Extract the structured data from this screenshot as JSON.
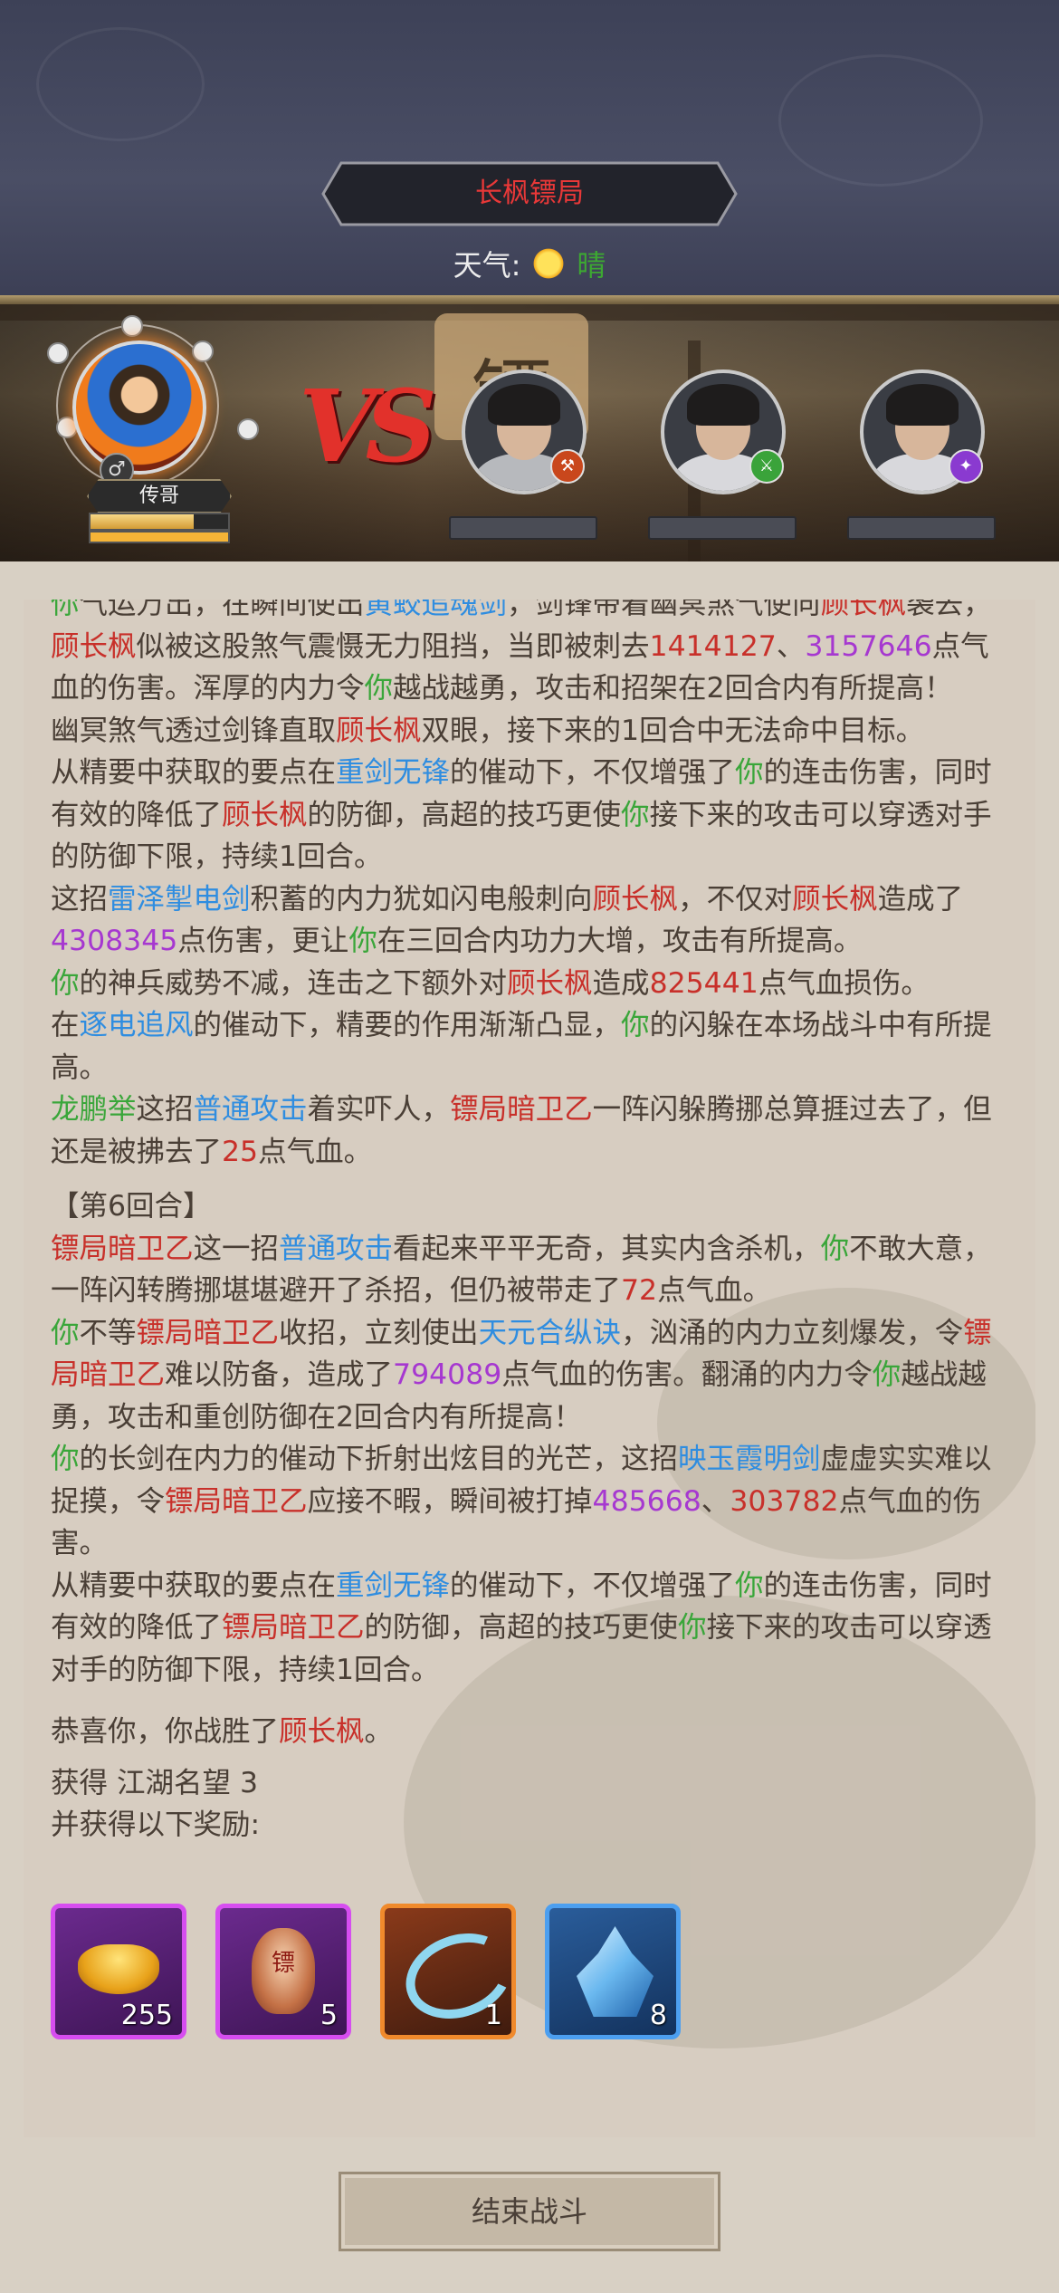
{
  "header": {
    "title": "长枫镖局",
    "weather_label": "天气:",
    "weather_value": "晴",
    "weather_icon": "sun-icon"
  },
  "banner": {
    "sign_char": "镖",
    "vs_text": "VS",
    "hero": {
      "name": "传哥",
      "gender_icon": "♂",
      "hp_fraction": 0.75,
      "energy_fraction": 1.0
    },
    "enemies": [
      {
        "weapon_icon": "axe-icon",
        "weapon_color": "#c9471c"
      },
      {
        "weapon_icon": "sword-icon",
        "weapon_color": "#3aa33a"
      },
      {
        "weapon_icon": "staff-icon",
        "weapon_color": "#8a3ad0"
      }
    ]
  },
  "log": {
    "lines": [
      [
        {
          "t": "你",
          "c": "g"
        },
        {
          "t": "气运万出，在瞬间使出"
        },
        {
          "t": "黄蛟追魂剑",
          "c": "b"
        },
        {
          "t": "，剑锋带着幽冥煞气使向"
        },
        {
          "t": "顾长枫",
          "c": "r"
        },
        {
          "t": "袭去，"
        },
        {
          "t": "顾长枫",
          "c": "r"
        },
        {
          "t": "似被这股煞气震慑无力阻挡，当即被刺去"
        },
        {
          "t": "1414127",
          "c": "r"
        },
        {
          "t": "、"
        },
        {
          "t": "3157646",
          "c": "p"
        },
        {
          "t": "点气血的伤害。浑厚的内力令"
        },
        {
          "t": "你",
          "c": "g"
        },
        {
          "t": "越战越勇，攻击和招架在2回合内有所提高！"
        }
      ],
      [
        {
          "t": "幽冥煞气透过剑锋直取"
        },
        {
          "t": "顾长枫",
          "c": "r"
        },
        {
          "t": "双眼，接下来的1回合中无法命中目标。"
        }
      ],
      [
        {
          "t": "从精要中获取的要点在"
        },
        {
          "t": "重剑无锋",
          "c": "b"
        },
        {
          "t": "的催动下，不仅增强了"
        },
        {
          "t": "你",
          "c": "g"
        },
        {
          "t": "的连击伤害，同时有效的降低了"
        },
        {
          "t": "顾长枫",
          "c": "r"
        },
        {
          "t": "的防御，高超的技巧更使"
        },
        {
          "t": "你",
          "c": "g"
        },
        {
          "t": "接下来的攻击可以穿透对手的防御下限，持续1回合。"
        }
      ],
      [
        {
          "t": "这招"
        },
        {
          "t": "雷泽掣电剑",
          "c": "b"
        },
        {
          "t": "积蓄的内力犹如闪电般刺向"
        },
        {
          "t": "顾长枫",
          "c": "r"
        },
        {
          "t": "，不仅对"
        },
        {
          "t": "顾长枫",
          "c": "r"
        },
        {
          "t": "造成了"
        },
        {
          "t": "4308345",
          "c": "p"
        },
        {
          "t": "点伤害，更让"
        },
        {
          "t": "你",
          "c": "g"
        },
        {
          "t": "在三回合内功力大增，攻击有所提高。"
        }
      ],
      [
        {
          "t": "你",
          "c": "g"
        },
        {
          "t": "的神兵威势不减，连击之下额外对"
        },
        {
          "t": "顾长枫",
          "c": "r"
        },
        {
          "t": "造成"
        },
        {
          "t": "825441",
          "c": "r"
        },
        {
          "t": "点气血损伤。"
        }
      ],
      [
        {
          "t": "在"
        },
        {
          "t": "逐电追风",
          "c": "b"
        },
        {
          "t": "的催动下，精要的作用渐渐凸显，"
        },
        {
          "t": "你",
          "c": "g"
        },
        {
          "t": "的闪躲在本场战斗中有所提高。"
        }
      ],
      [
        {
          "t": "龙鹏举",
          "c": "g"
        },
        {
          "t": "这招"
        },
        {
          "t": "普通攻击",
          "c": "b"
        },
        {
          "t": "着实吓人，"
        },
        {
          "t": "镖局暗卫乙",
          "c": "r"
        },
        {
          "t": "一阵闪躲腾挪总算捱过去了，但还是被拂去了"
        },
        {
          "t": "25",
          "c": "r"
        },
        {
          "t": "点气血。"
        }
      ]
    ],
    "round_label": "【第6回合】",
    "round_lines": [
      [
        {
          "t": "镖局暗卫乙",
          "c": "r"
        },
        {
          "t": "这一招"
        },
        {
          "t": "普通攻击",
          "c": "b"
        },
        {
          "t": "看起来平平无奇，其实内含杀机，"
        },
        {
          "t": "你",
          "c": "g"
        },
        {
          "t": "不敢大意，一阵闪转腾挪堪堪避开了杀招，但仍被带走了"
        },
        {
          "t": "72",
          "c": "r"
        },
        {
          "t": "点气血。"
        }
      ],
      [
        {
          "t": "你",
          "c": "g"
        },
        {
          "t": "不等"
        },
        {
          "t": "镖局暗卫乙",
          "c": "r"
        },
        {
          "t": "收招，立刻使出"
        },
        {
          "t": "天元合纵诀",
          "c": "b"
        },
        {
          "t": "，汹涌的内力立刻爆发，令"
        },
        {
          "t": "镖局暗卫乙",
          "c": "r"
        },
        {
          "t": "难以防备，造成了"
        },
        {
          "t": "794089",
          "c": "p"
        },
        {
          "t": "点气血的伤害。翻涌的内力令"
        },
        {
          "t": "你",
          "c": "g"
        },
        {
          "t": "越战越勇，攻击和重创防御在2回合内有所提高！"
        }
      ],
      [
        {
          "t": "你",
          "c": "g"
        },
        {
          "t": "的长剑在内力的催动下折射出炫目的光芒，这招"
        },
        {
          "t": "映玉霞明剑",
          "c": "b"
        },
        {
          "t": "虚虚实实难以捉摸，令"
        },
        {
          "t": "镖局暗卫乙",
          "c": "r"
        },
        {
          "t": "应接不暇，瞬间被打掉"
        },
        {
          "t": "485668",
          "c": "p"
        },
        {
          "t": "、"
        },
        {
          "t": "303782",
          "c": "r"
        },
        {
          "t": "点气血的伤害。"
        }
      ],
      [
        {
          "t": "从精要中获取的要点在"
        },
        {
          "t": "重剑无锋",
          "c": "b"
        },
        {
          "t": "的催动下，不仅增强了"
        },
        {
          "t": "你",
          "c": "g"
        },
        {
          "t": "的连击伤害，同时有效的降低了"
        },
        {
          "t": "镖局暗卫乙",
          "c": "r"
        },
        {
          "t": "的防御，高超的技巧更使"
        },
        {
          "t": "你",
          "c": "g"
        },
        {
          "t": "接下来的攻击可以穿透对手的防御下限，持续1回合。"
        }
      ]
    ],
    "victory_line": [
      {
        "t": "恭喜你，你战胜了"
      },
      {
        "t": "顾长枫",
        "c": "r"
      },
      {
        "t": "。"
      }
    ],
    "gain_line": "获得 江湖名望 3",
    "rewards_label": "并获得以下奖励:"
  },
  "rewards": [
    {
      "icon": "gold-ingot-icon",
      "count": "255",
      "rarity": "purple"
    },
    {
      "icon": "escort-token-icon",
      "count": "5",
      "rarity": "purple",
      "glyph": "镖"
    },
    {
      "icon": "cloud-swirl-icon",
      "count": "1",
      "rarity": "orange"
    },
    {
      "icon": "blue-crystal-icon",
      "count": "8",
      "rarity": "blue"
    }
  ],
  "footer": {
    "end_button": "结束战斗"
  }
}
